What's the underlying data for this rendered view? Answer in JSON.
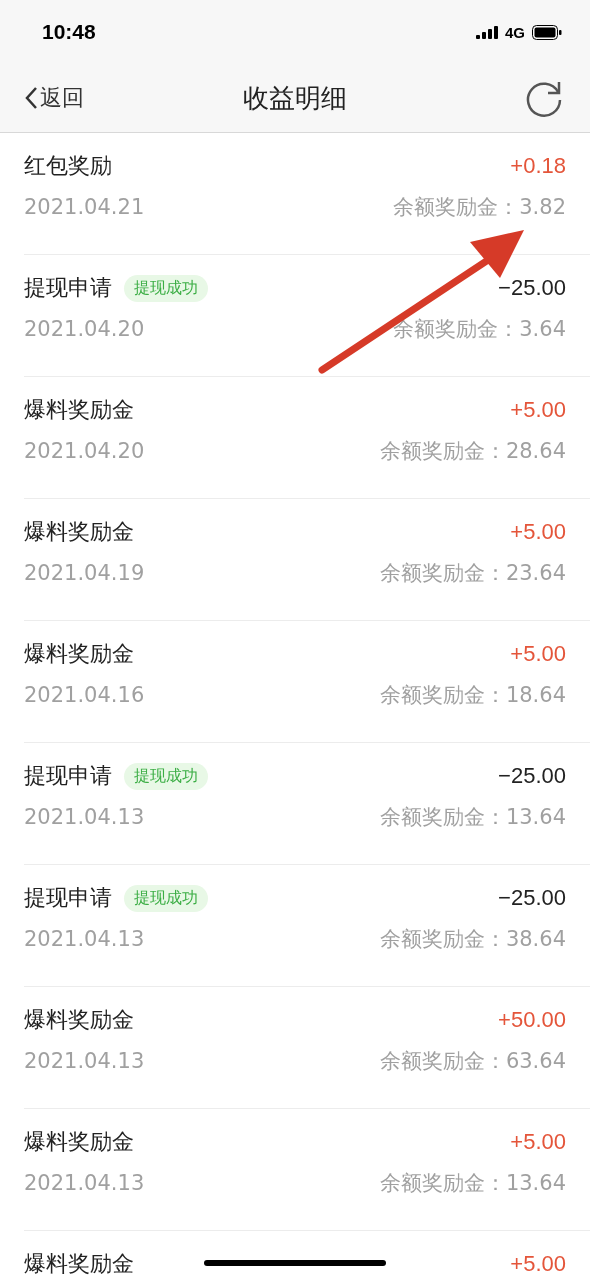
{
  "status_bar": {
    "time": "10:48",
    "network": "4G"
  },
  "nav": {
    "back": "返回",
    "title": "收益明细"
  },
  "records": [
    {
      "title": "红包奖励",
      "kind": "credit",
      "amount": "+0.18",
      "date": "2021.04.21",
      "balance": "余额奖励金：3.82"
    },
    {
      "title": "提现申请",
      "badge": "提现成功",
      "kind": "debit",
      "amount": "−25.00",
      "date": "2021.04.20",
      "balance": "余额奖励金：3.64"
    },
    {
      "title": "爆料奖励金",
      "kind": "credit",
      "amount": "+5.00",
      "date": "2021.04.20",
      "balance": "余额奖励金：28.64"
    },
    {
      "title": "爆料奖励金",
      "kind": "credit",
      "amount": "+5.00",
      "date": "2021.04.19",
      "balance": "余额奖励金：23.64"
    },
    {
      "title": "爆料奖励金",
      "kind": "credit",
      "amount": "+5.00",
      "date": "2021.04.16",
      "balance": "余额奖励金：18.64"
    },
    {
      "title": "提现申请",
      "badge": "提现成功",
      "kind": "debit",
      "amount": "−25.00",
      "date": "2021.04.13",
      "balance": "余额奖励金：13.64"
    },
    {
      "title": "提现申请",
      "badge": "提现成功",
      "kind": "debit",
      "amount": "−25.00",
      "date": "2021.04.13",
      "balance": "余额奖励金：38.64"
    },
    {
      "title": "爆料奖励金",
      "kind": "credit",
      "amount": "+50.00",
      "date": "2021.04.13",
      "balance": "余额奖励金：63.64"
    },
    {
      "title": "爆料奖励金",
      "kind": "credit",
      "amount": "+5.00",
      "date": "2021.04.13",
      "balance": "余额奖励金：13.64"
    },
    {
      "title": "爆料奖励金",
      "kind": "credit",
      "amount": "+5.00"
    }
  ]
}
